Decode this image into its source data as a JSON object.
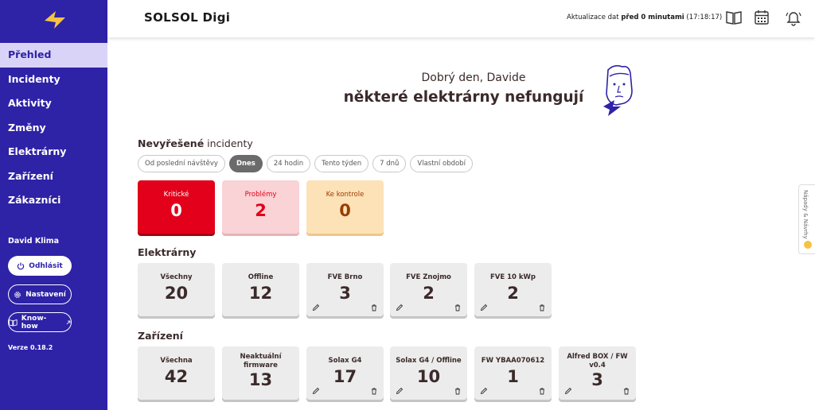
{
  "sidebar": {
    "items": [
      {
        "label": "Přehled",
        "active": true
      },
      {
        "label": "Incidenty"
      },
      {
        "label": "Aktivity"
      },
      {
        "label": "Změny"
      },
      {
        "label": "Elektrárny"
      },
      {
        "label": "Zařízení"
      },
      {
        "label": "Zákazníci"
      }
    ],
    "user_name": "David Klima",
    "logout_label": "Odhlásit",
    "settings_label": "Nastavení",
    "knowhow_label": "Know-how",
    "version": "Verze 0.18.2"
  },
  "header": {
    "title": "SOLSOL Digi",
    "update_prefix": "Aktualizace dat ",
    "update_bold": "před 0 minutami",
    "update_time": " (17:18:17)",
    "icons": [
      "book-icon",
      "calendar-icon",
      "bell-icon"
    ]
  },
  "greeting": {
    "sub": "Dobrý den, Davide",
    "main": "některé elektrárny nefungují"
  },
  "incidents": {
    "title_bold": "Nevyřešené",
    "title_rest": " incidenty",
    "filters": [
      "Od poslední návštěvy",
      "Dnes",
      "24 hodin",
      "Tento týden",
      "7 dnů",
      "Vlastní období"
    ],
    "active_filter": "Dnes",
    "tiles": [
      {
        "label": "Kritické",
        "value": "0"
      },
      {
        "label": "Problémy",
        "value": "2"
      },
      {
        "label": "Ke kontrole",
        "value": "0"
      }
    ]
  },
  "plants": {
    "title": "Elektrárny",
    "cards": [
      {
        "label": "Všechny",
        "value": "20",
        "editable": false
      },
      {
        "label": "Offline",
        "value": "12",
        "editable": false
      },
      {
        "label": "FVE Brno",
        "value": "3",
        "editable": true
      },
      {
        "label": "FVE Znojmo",
        "value": "2",
        "editable": true
      },
      {
        "label": "FVE 10 kWp",
        "value": "2",
        "editable": true
      }
    ]
  },
  "devices": {
    "title": "Zařízení",
    "cards": [
      {
        "label": "Všechna",
        "value": "42",
        "editable": false
      },
      {
        "label": "Neaktuální firmware",
        "value": "13",
        "editable": false
      },
      {
        "label": "Solax G4",
        "value": "17",
        "editable": true
      },
      {
        "label": "Solax G4 / Offline",
        "value": "10",
        "editable": true
      },
      {
        "label": "FW YBAA070612",
        "value": "1",
        "editable": true
      },
      {
        "label": "Alfred BOX / FW v0.4",
        "value": "3",
        "editable": true
      }
    ]
  },
  "feedback": {
    "label": "Nápady & Návrhy"
  },
  "colors": {
    "sidebar": "#2e22a7",
    "active_nav": "#d9d4f7",
    "critical": "#e2001a",
    "logo": "#f5c343"
  }
}
